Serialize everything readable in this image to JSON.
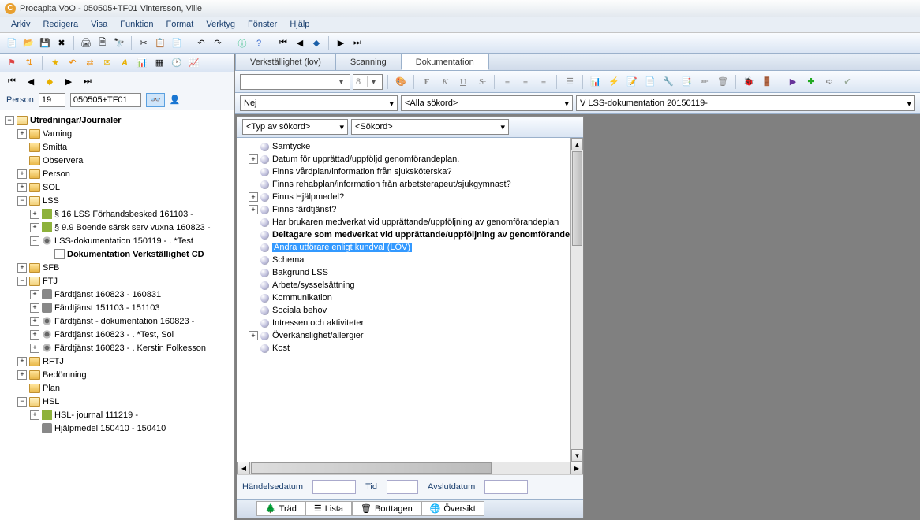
{
  "window": {
    "title": "Procapita VoO - 050505+TF01 Vintersson, Ville"
  },
  "menu": [
    "Arkiv",
    "Redigera",
    "Visa",
    "Funktion",
    "Format",
    "Verktyg",
    "Fönster",
    "Hjälp"
  ],
  "person": {
    "label": "Person",
    "id_value": "19",
    "num_value": "050505+TF01"
  },
  "tree": {
    "root": "Utredningar/Journaler",
    "items": [
      {
        "level": 1,
        "exp": "+",
        "icon": "folder",
        "label": "Varning"
      },
      {
        "level": 1,
        "exp": "",
        "icon": "folder",
        "label": "Smitta"
      },
      {
        "level": 1,
        "exp": "",
        "icon": "folder",
        "label": "Observera"
      },
      {
        "level": 1,
        "exp": "+",
        "icon": "folder",
        "label": "Person"
      },
      {
        "level": 1,
        "exp": "+",
        "icon": "folder",
        "label": "SOL"
      },
      {
        "level": 1,
        "exp": "-",
        "icon": "folder-open",
        "label": "LSS"
      },
      {
        "level": 2,
        "exp": "+",
        "icon": "green",
        "label": "§ 16 LSS Förhandsbesked 161103 -"
      },
      {
        "level": 2,
        "exp": "+",
        "icon": "green",
        "label": "§ 9.9 Boende särsk serv vuxna 160823 -"
      },
      {
        "level": 2,
        "exp": "-",
        "icon": "gear",
        "label": "LSS-dokumentation 150119 - . *Test"
      },
      {
        "level": 3,
        "exp": "",
        "icon": "doc",
        "label": "Dokumentation Verkställighet CD",
        "bold": true
      },
      {
        "level": 1,
        "exp": "+",
        "icon": "folder",
        "label": "SFB"
      },
      {
        "level": 1,
        "exp": "-",
        "icon": "folder-open",
        "label": "FTJ"
      },
      {
        "level": 2,
        "exp": "+",
        "icon": "car",
        "label": "Färdtjänst 160823 - 160831"
      },
      {
        "level": 2,
        "exp": "+",
        "icon": "car",
        "label": "Färdtjänst 151103 - 151103"
      },
      {
        "level": 2,
        "exp": "+",
        "icon": "gear",
        "label": "Färdtjänst - dokumentation 160823 -"
      },
      {
        "level": 2,
        "exp": "+",
        "icon": "gear",
        "label": "Färdtjänst 160823 - . *Test, Sol"
      },
      {
        "level": 2,
        "exp": "+",
        "icon": "gear",
        "label": "Färdtjänst 160823 - . Kerstin Folkesson"
      },
      {
        "level": 1,
        "exp": "+",
        "icon": "folder",
        "label": "RFTJ"
      },
      {
        "level": 1,
        "exp": "+",
        "icon": "folder",
        "label": "Bedömning"
      },
      {
        "level": 1,
        "exp": "",
        "icon": "folder",
        "label": "Plan"
      },
      {
        "level": 1,
        "exp": "-",
        "icon": "folder-open",
        "label": "HSL"
      },
      {
        "level": 2,
        "exp": "+",
        "icon": "green",
        "label": "HSL- journal 111219 -"
      },
      {
        "level": 2,
        "exp": "",
        "icon": "car",
        "label": "Hjälpmedel 150410 - 150410"
      }
    ]
  },
  "tabs": [
    {
      "label": "Verkställighet (lov)",
      "active": false
    },
    {
      "label": "Scanning",
      "active": false
    },
    {
      "label": "Dokumentation",
      "active": true
    }
  ],
  "format_bar": {
    "font_name": "",
    "font_size": "8"
  },
  "filters": {
    "select1": "Nej",
    "select2": "<Alla sökord>",
    "select3": "V LSS-dokumentation 20150119-",
    "type_sel": "<Typ av sökord>",
    "sokord_sel": "<Sökord>"
  },
  "keywords": [
    {
      "exp": "",
      "label": "Samtycke"
    },
    {
      "exp": "+",
      "label": "Datum för upprättad/uppföljd genomförandeplan."
    },
    {
      "exp": "",
      "label": "Finns vårdplan/information från sjuksköterska?"
    },
    {
      "exp": "",
      "label": "Finns rehabplan/information från arbetsterapeut/sjukgymnast?"
    },
    {
      "exp": "+",
      "label": "Finns Hjälpmedel?"
    },
    {
      "exp": "+",
      "label": "Finns färdtjänst?"
    },
    {
      "exp": "",
      "label": "Har brukaren medverkat vid upprättande/uppföljning av genomförandeplan"
    },
    {
      "exp": "",
      "label": "Deltagare som medverkat vid upprättande/uppföljning av genomförandeplan",
      "bold": true
    },
    {
      "exp": "",
      "label": "Andra utförare enligt kundval (LOV)",
      "selected": true
    },
    {
      "exp": "",
      "label": "Schema"
    },
    {
      "exp": "",
      "label": "Bakgrund LSS"
    },
    {
      "exp": "",
      "label": "Arbete/sysselsättning"
    },
    {
      "exp": "",
      "label": "Kommunikation"
    },
    {
      "exp": "",
      "label": "Sociala behov"
    },
    {
      "exp": "",
      "label": "Intressen och aktiviteter"
    },
    {
      "exp": "+",
      "label": "Överkänslighet/allergier"
    },
    {
      "exp": "",
      "label": "Kost"
    }
  ],
  "bottom": {
    "handelse_label": "Händelsedatum",
    "tid_label": "Tid",
    "avslut_label": "Avslutdatum"
  },
  "view_tabs": [
    "Träd",
    "Lista",
    "Borttagen",
    "Översikt"
  ]
}
